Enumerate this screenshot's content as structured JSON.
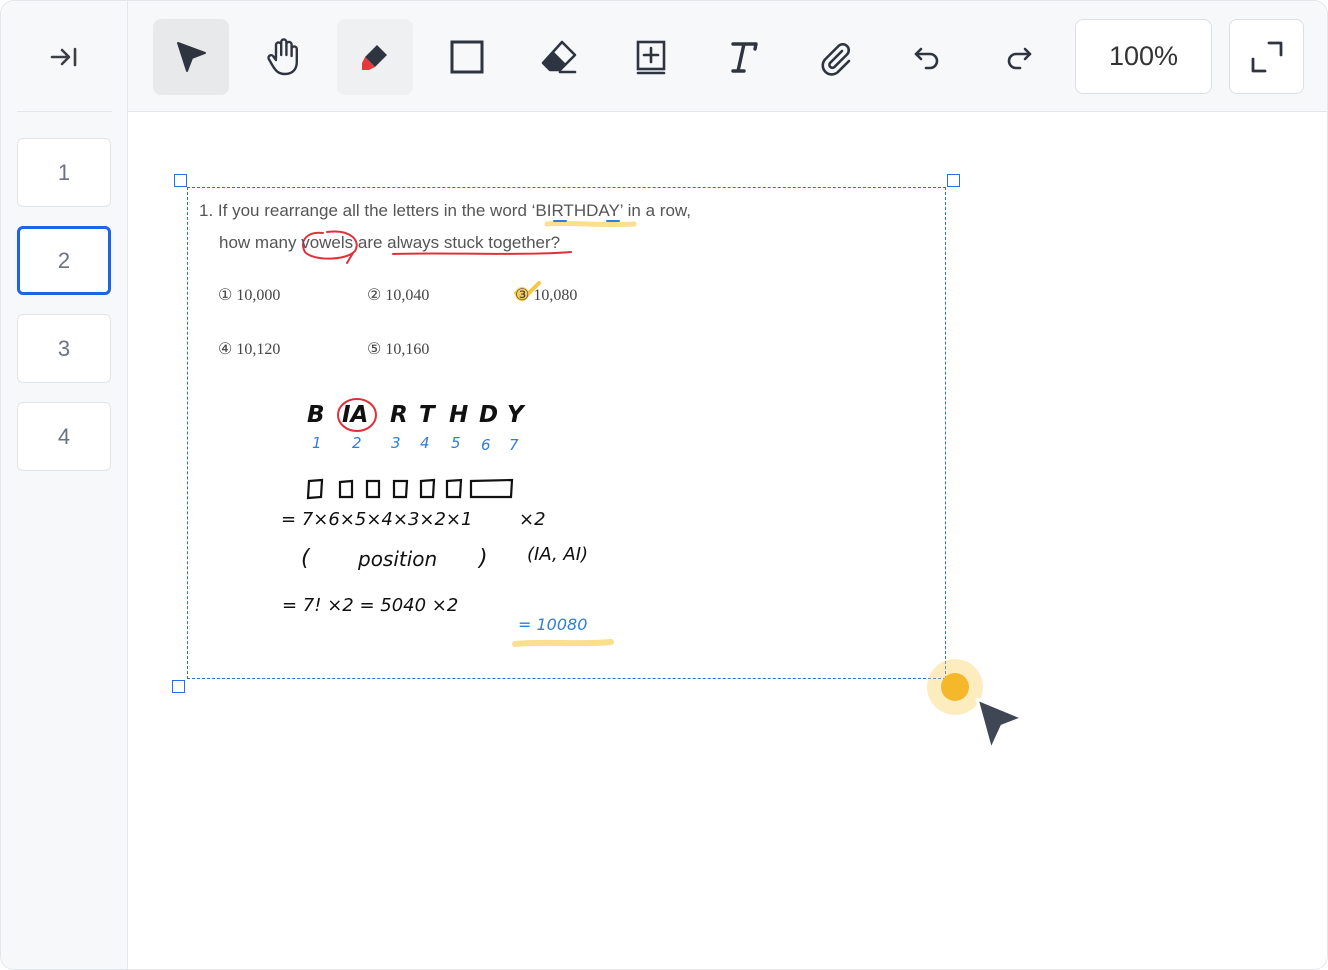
{
  "sidebar": {
    "collapse_icon": "collapse-right-icon",
    "pages": [
      {
        "label": "1"
      },
      {
        "label": "2",
        "active": true
      },
      {
        "label": "3"
      },
      {
        "label": "4"
      }
    ]
  },
  "toolbar": {
    "tools": [
      {
        "name": "select-tool",
        "icon": "cursor-arrow-icon",
        "selected": true
      },
      {
        "name": "hand-tool",
        "icon": "hand-icon"
      },
      {
        "name": "highlighter-tool",
        "icon": "highlighter-icon",
        "accent": "#e5393b"
      },
      {
        "name": "rectangle-tool",
        "icon": "square-icon"
      },
      {
        "name": "eraser-tool",
        "icon": "eraser-icon"
      },
      {
        "name": "add-page-tool",
        "icon": "add-box-icon"
      },
      {
        "name": "text-tool",
        "icon": "text-t-icon"
      },
      {
        "name": "attach-tool",
        "icon": "paperclip-icon"
      },
      {
        "name": "undo-tool",
        "icon": "undo-icon"
      },
      {
        "name": "redo-tool",
        "icon": "redo-icon"
      }
    ],
    "zoom": "100%",
    "fullscreen_icon": "expand-icon"
  },
  "document": {
    "question_line1": "1. If you rearrange all the letters in the word ‘BIRTHDAY’ in a row,",
    "question_line2": "how many vowels are always stuck together?",
    "choices": [
      "① 10,000",
      "② 10,040",
      "③ 10,080",
      "④ 10,120",
      "⑤ 10,160"
    ],
    "correct_choice": 3
  },
  "handwriting": {
    "letters": [
      "B",
      "IA",
      "R",
      "T",
      "H",
      "D",
      "Y"
    ],
    "numbers": [
      "1",
      "2",
      "3",
      "4",
      "5",
      "6",
      "7"
    ],
    "line1": "= 7×6×5×4×3×2×1",
    "line1_mult": "×2",
    "open_paren": "(",
    "position_word": "position",
    "close_paren": ")",
    "pairs": "(IA, AI)",
    "line3": "= 7! ×2 = 5040 ×2",
    "answer": "= 10080"
  },
  "colors": {
    "accent_blue": "#1f63e6",
    "selection_blue": "#2a6de8",
    "annotation_red": "#e0313b",
    "highlight_yellow": "#f6c945",
    "handwriting_blue": "#2f7ed8",
    "cursor_dark": "#3f4654"
  }
}
